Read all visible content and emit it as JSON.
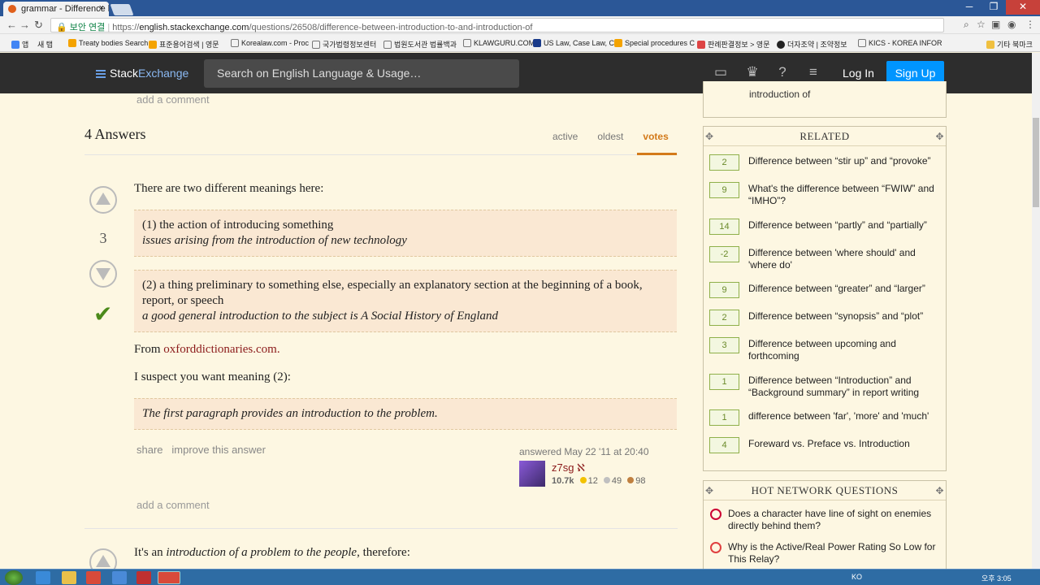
{
  "browser": {
    "tab_title": "grammar - Difference b",
    "tab_close": "×",
    "url_secure_label": "보안 연결",
    "url_prefix": "https://",
    "url_host": "english.stackexchange.com",
    "url_path": "/questions/26508/difference-between-introduction-to-and-introduction-of",
    "win_min": "─",
    "win_max": "❐",
    "win_close": "✕",
    "bookmarks": [
      "앱",
      "새 탭",
      "Treaty bodies Search",
      "표준용어검색 | 영문",
      "Korealaw.com - Proc",
      "국가법령정보센터",
      "법원도서관 법률백과",
      "KLAWGURU.COM",
      "US Law, Case Law, C",
      "Special procedures C",
      "판례판결정보 > 영문",
      "더자조약 | 조약정보",
      "KICS - KOREA INFOR",
      "기타 북마크"
    ]
  },
  "header": {
    "logo_stack": "Stack",
    "logo_exchange": "Exchange",
    "search_placeholder": "Search on English Language & Usage…",
    "login": "Log In",
    "signup": "Sign Up"
  },
  "main": {
    "top_add_comment": "add a comment",
    "answers_heading": "4 Answers",
    "sort_tabs": [
      "active",
      "oldest",
      "votes"
    ],
    "answer1": {
      "votes": "3",
      "intro": "There are two different meanings here:",
      "q1_line1": "(1) the action of introducing something",
      "q1_line2": "issues arising from the introduction of new technology",
      "q2_line1": "(2) a thing preliminary to something else, especially an explanatory section at the beginning of a book, report, or speech",
      "q2_line2": "a good general introduction to the subject is A Social History of England",
      "from_label": "From ",
      "from_link": "oxforddictionaries.com",
      "from_end": ".",
      "suspect": "I suspect you want meaning (2):",
      "q3": "The first paragraph provides an introduction to the problem.",
      "share": "share",
      "improve": "improve this answer",
      "answered": "answered May 22 '11 at 20:40",
      "user": "z7sg",
      "user_mod": "ℵ",
      "rep": "10.7k",
      "gold": "12",
      "silver": "49",
      "bronze": "98",
      "add_comment": "add a comment"
    },
    "answer2": {
      "text_a": "It's an ",
      "text_b": "introduction of a problem to the people",
      "text_c": ", therefore:"
    }
  },
  "sidebar": {
    "top_fragment": "introduction of",
    "related_title": "RELATED",
    "related": [
      {
        "count": "2",
        "title": "Difference between “stir up” and “provoke”"
      },
      {
        "count": "9",
        "title": "What's the difference between “FWIW” and “IMHO”?"
      },
      {
        "count": "14",
        "title": "Difference between “partly” and “partially”"
      },
      {
        "count": "-2",
        "title": "Difference between 'where should' and 'where do'"
      },
      {
        "count": "9",
        "title": "Difference between “greater” and “larger”"
      },
      {
        "count": "2",
        "title": "Difference between “synopsis” and “plot”"
      },
      {
        "count": "3",
        "title": "Difference between upcoming and forthcoming"
      },
      {
        "count": "1",
        "title": "Difference between “Introduction” and “Background summary” in report writing"
      },
      {
        "count": "1",
        "title": "difference between 'far', 'more' and 'much'"
      },
      {
        "count": "4",
        "title": "Foreward vs. Preface vs. Introduction"
      }
    ],
    "hnq_title": "HOT NETWORK QUESTIONS",
    "hnq": [
      {
        "title": "Does a character have line of sight on enemies directly behind them?"
      },
      {
        "title": "Why is the Active/Real Power Rating So Low for This Relay?"
      }
    ]
  },
  "taskbar": {
    "lang": "KO",
    "time": "오후 3:05"
  },
  "colors": {
    "accent": "#d37a1a",
    "signup": "#0095ff",
    "link": "#8b1a1a",
    "background": "#fdf7e2"
  }
}
